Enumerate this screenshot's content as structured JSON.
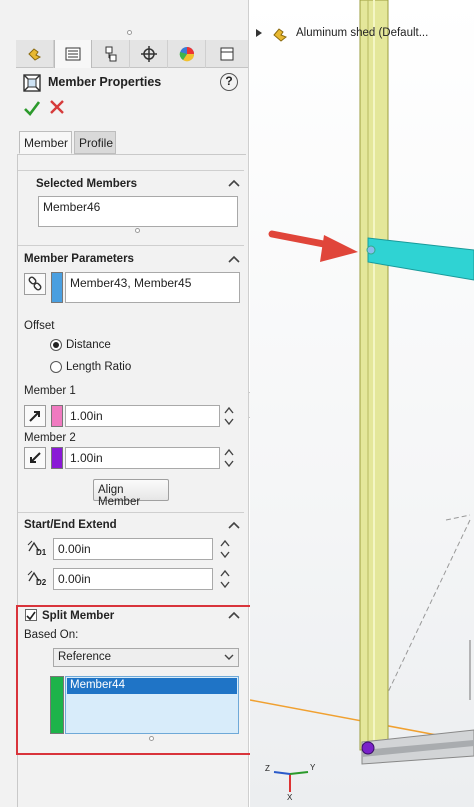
{
  "panel": {
    "title": "Member Properties",
    "help_label": "?",
    "tabs": [
      "Member",
      "Profile"
    ],
    "selected_members": {
      "heading": "Selected Members",
      "value": "Member46"
    },
    "member_parameters": {
      "heading": "Member Parameters",
      "members_value": "Member43, Member45",
      "offset_label": "Offset",
      "option_distance": "Distance",
      "option_length_ratio": "Length Ratio",
      "member1_label": "Member 1",
      "member1_value": "1.00in",
      "member2_label": "Member 2",
      "member2_value": "1.00in",
      "align_button": "Align Member"
    },
    "start_end_extend": {
      "heading": "Start/End Extend",
      "d1_value": "0.00in",
      "d2_value": "0.00in",
      "d1_tag": "D1",
      "d2_tag": "D2"
    },
    "split_member": {
      "heading": "Split Member",
      "checked": true,
      "based_on_label": "Based On:",
      "based_on_value": "Reference",
      "list_items": [
        "Member44"
      ]
    }
  },
  "viewport": {
    "tree_label": "Aluminum shed (Default...",
    "triad_labels": {
      "y": "Y",
      "x": "X",
      "z": "Z"
    }
  },
  "colors": {
    "member_params_swatch": "#4a9fe0",
    "member1_swatch": "#f07ac0",
    "member2_swatch": "#8a19d6",
    "split_swatch": "#1db34a",
    "highlight_border": "#d9343b",
    "arrow": "#e0453a",
    "yellow_beam": "#e4e79a",
    "cyan_beam": "#2fd3d3",
    "orange_line": "#f0a030"
  },
  "icons": {
    "toptabs": [
      "feature-manager-icon",
      "property-manager-icon",
      "configuration-manager-icon",
      "dimxpert-icon",
      "display-manager-icon",
      "cam-icon"
    ]
  }
}
